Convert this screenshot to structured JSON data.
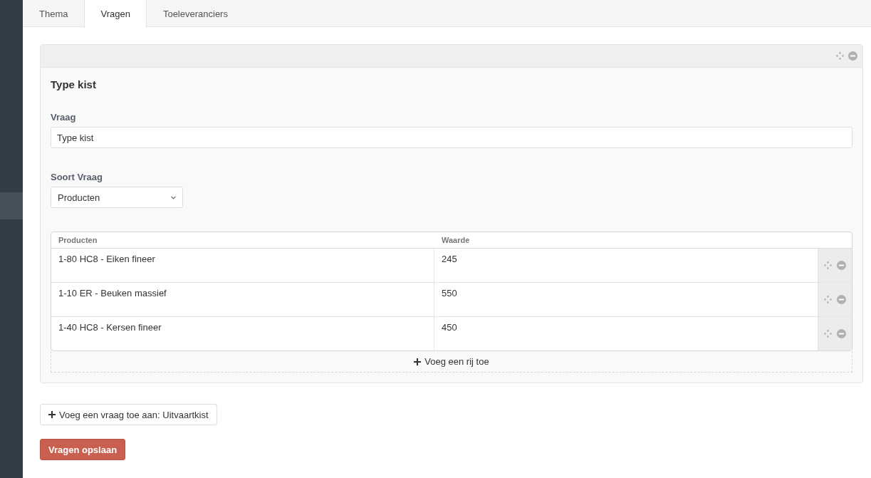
{
  "tabs": [
    {
      "label": "Thema",
      "selected": false
    },
    {
      "label": "Vragen",
      "selected": true
    },
    {
      "label": "Toeleveranciers",
      "selected": false
    }
  ],
  "question": {
    "title": "Type kist",
    "fields": [
      {
        "label": "Vraag",
        "kind": "text",
        "value": "Type kist"
      },
      {
        "label": "Soort Vraag",
        "kind": "select",
        "value": "Producten"
      }
    ],
    "table": {
      "columns": [
        "Producten",
        "Waarde"
      ],
      "rows": [
        {
          "product": "1-80 HC8 - Eiken fineer",
          "value": "245"
        },
        {
          "product": "1-10 ER - Beuken massief",
          "value": "550"
        },
        {
          "product": "1-40 HC8 - Kersen fineer",
          "value": "450"
        }
      ],
      "add_row": "Voeg een rij toe"
    }
  },
  "add_question": "Voeg een vraag toe aan: Uitvaartkist",
  "save": "Vragen opslaan"
}
